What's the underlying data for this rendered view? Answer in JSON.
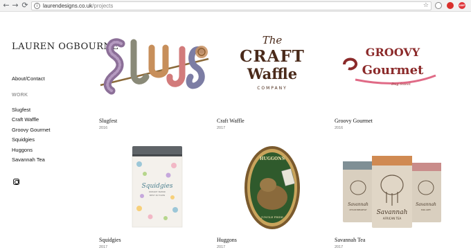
{
  "browser": {
    "url_domain": "laurendesigns.co.uk",
    "url_path": "/projects"
  },
  "sidebar": {
    "logo": "LAUREN OGBOURNE",
    "about_label": "About/Contact",
    "work_heading": "WORK",
    "items": [
      {
        "label": "Slugfest"
      },
      {
        "label": "Craft Waffle"
      },
      {
        "label": "Groovy Gourmet"
      },
      {
        "label": "Squidgies"
      },
      {
        "label": "Huggons"
      },
      {
        "label": "Savannah Tea"
      }
    ]
  },
  "projects": [
    {
      "title": "Slugfest",
      "year": "2016"
    },
    {
      "title": "Craft Waffle",
      "year": "2017",
      "logo_the": "The",
      "logo_craft": "CRAFT",
      "logo_waffle": "Waffle",
      "logo_company": "COMPANY"
    },
    {
      "title": "Groovy Gourmet",
      "year": "2016",
      "logo_groovy": "GROOVY",
      "logo_gourmet": "Gourmet",
      "logo_tag": "Dug Sweet"
    },
    {
      "title": "Squidgies",
      "year": "2017",
      "tin_label": "Squidgies",
      "tin_sub": "DREAMY BLEND",
      "tin_sub2": "BEST IN TOWN"
    },
    {
      "title": "Huggons",
      "year": "2017",
      "badge_top": "HUGGONS",
      "badge_bottom": "JUNGLE PRIDE"
    },
    {
      "title": "Savannah Tea",
      "year": "2017",
      "bag_left": "Savannah",
      "bag_left_sub": "CEYLON BREAKFAST",
      "bag_center": "Savannah",
      "bag_center_sub": "AFRICAN TEA",
      "bag_right": "Savannah",
      "bag_right_sub": "EARL GREY"
    }
  ]
}
